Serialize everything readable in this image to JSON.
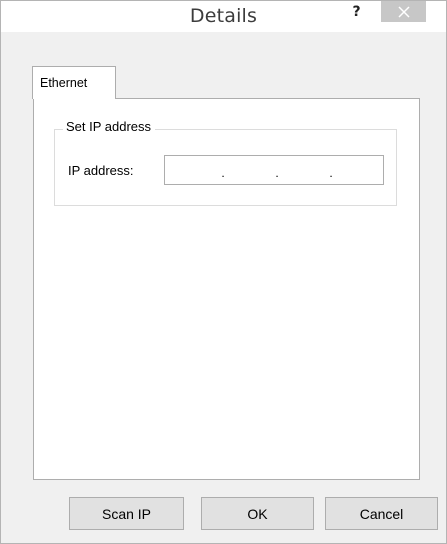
{
  "window": {
    "title": "Details",
    "help_label": "?"
  },
  "icons": {
    "close": "close-icon"
  },
  "tabs": [
    {
      "label": "Ethernet",
      "selected": true
    }
  ],
  "group": {
    "title": "Set IP address",
    "ip_label": "IP address:",
    "ip_value": "",
    "ip_separator": "."
  },
  "buttons": {
    "scan_label": "Scan IP",
    "ok_label": "OK",
    "cancel_label": "Cancel"
  },
  "colors": {
    "close_hover": "#c7c7c7",
    "button_face": "#e1e1e1",
    "border": "#adadad"
  }
}
